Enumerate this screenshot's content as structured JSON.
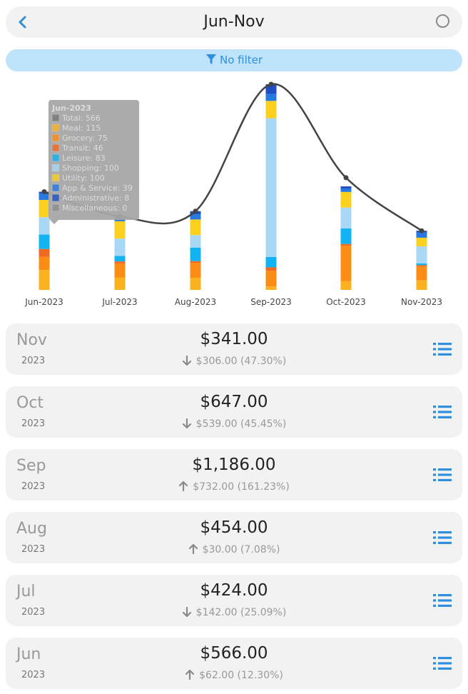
{
  "header": {
    "title": "Jun-Nov",
    "back_icon": "chevron-left-icon",
    "radio_icon": "radio-circle-icon"
  },
  "filter": {
    "label": "No filter",
    "icon": "filter-funnel-icon",
    "color": "#2f8fdc"
  },
  "colors": {
    "Meal": "#fbb21e",
    "Grocery": "#fb8c14",
    "Transit": "#f26a21",
    "Leisure": "#11b3f2",
    "Shopping": "#a8d8f6",
    "Utility": "#fcd01e",
    "App & Service": "#2579e0",
    "Administrative": "#1e4fc2",
    "Miscellaneous": "#8c8c8c"
  },
  "chart_data": {
    "type": "bar",
    "stacked": true,
    "categories": [
      "Jun-2023",
      "Jul-2023",
      "Aug-2023",
      "Sep-2023",
      "Oct-2023",
      "Nov-2023"
    ],
    "series": [
      {
        "name": "Meal",
        "values": [
          115,
          72,
          70,
          20,
          50,
          55
        ]
      },
      {
        "name": "Grocery",
        "values": [
          75,
          80,
          86,
          90,
          205,
          80
        ]
      },
      {
        "name": "Transit",
        "values": [
          46,
          12,
          10,
          20,
          10,
          8
        ]
      },
      {
        "name": "Leisure",
        "values": [
          83,
          32,
          78,
          60,
          90,
          10
        ]
      },
      {
        "name": "Shopping",
        "values": [
          100,
          100,
          72,
          800,
          120,
          98
        ]
      },
      {
        "name": "Utility",
        "values": [
          100,
          100,
          90,
          100,
          90,
          50
        ]
      },
      {
        "name": "App & Service",
        "values": [
          39,
          20,
          30,
          40,
          20,
          30
        ]
      },
      {
        "name": "Administrative",
        "values": [
          8,
          8,
          18,
          56,
          12,
          10
        ]
      },
      {
        "name": "Miscellaneous",
        "values": [
          0,
          0,
          0,
          0,
          0,
          0
        ]
      }
    ],
    "totals": [
      566,
      424,
      454,
      1186,
      647,
      341
    ],
    "trend_line": true,
    "tooltip": {
      "title": "Jun-2023",
      "lines": [
        "Total: 566",
        "Meal: 115",
        "Grocery: 75",
        "Transit: 46",
        "Leisure: 83",
        "Shopping: 100",
        "Utility: 100",
        "App & Service: 39",
        "Administrative: 8",
        "Miscellaneous: 0"
      ]
    }
  },
  "months": [
    {
      "month": "Nov",
      "year": "2023",
      "total": "$341.00",
      "change": "$306.00 (47.30%)",
      "direction": "down"
    },
    {
      "month": "Oct",
      "year": "2023",
      "total": "$647.00",
      "change": "$539.00 (45.45%)",
      "direction": "down"
    },
    {
      "month": "Sep",
      "year": "2023",
      "total": "$1,186.00",
      "change": "$732.00 (161.23%)",
      "direction": "up"
    },
    {
      "month": "Aug",
      "year": "2023",
      "total": "$454.00",
      "change": "$30.00 (7.08%)",
      "direction": "up"
    },
    {
      "month": "Jul",
      "year": "2023",
      "total": "$424.00",
      "change": "$142.00 (25.09%)",
      "direction": "down"
    },
    {
      "month": "Jun",
      "year": "2023",
      "total": "$566.00",
      "change": "$62.00 (12.30%)",
      "direction": "up"
    }
  ]
}
